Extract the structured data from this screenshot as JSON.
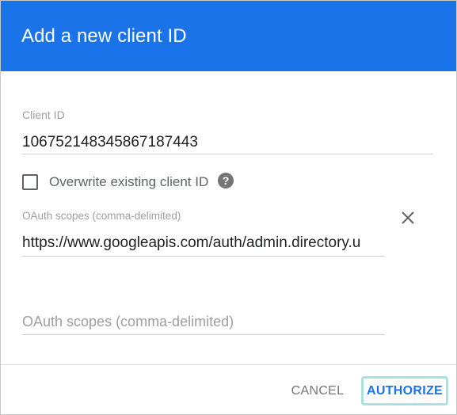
{
  "dialog": {
    "title": "Add a new client ID"
  },
  "client_id": {
    "label": "Client ID",
    "value": "106752148345867187443"
  },
  "overwrite": {
    "label": "Overwrite existing client ID",
    "checked": false,
    "help_icon": "help-circle-icon",
    "help_glyph": "?"
  },
  "scopes": {
    "label": "OAuth scopes (comma-delimited)",
    "value": "https://www.googleapis.com/auth/admin.directory.u",
    "remove_icon": "close-icon",
    "new_placeholder": "OAuth scopes (comma-delimited)"
  },
  "actions": {
    "cancel_label": "CANCEL",
    "authorize_label": "AUTHORIZE"
  },
  "colors": {
    "header": "#1a73e8",
    "accent": "#1a73e8",
    "focus_ring": "#a8e2e2"
  }
}
